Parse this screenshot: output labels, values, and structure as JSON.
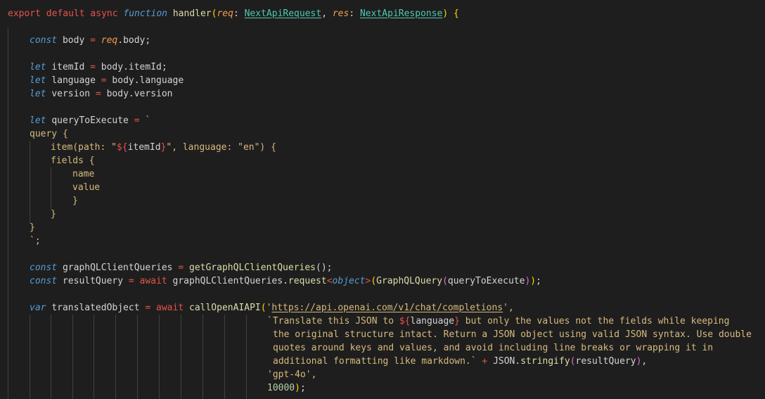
{
  "code": {
    "l1": {
      "export": "export",
      "default": "default",
      "async": "async",
      "function": "function",
      "name": "handler",
      "req": "req",
      "req_type": "NextApiRequest",
      "res": "res",
      "res_type": "NextApiResponse"
    },
    "l3": {
      "kw": "const",
      "var": "body",
      "rhs_param": "req",
      "rhs_prop": ".body;"
    },
    "l5": {
      "kw": "let",
      "text": "itemId",
      "rhs": "body.itemId;"
    },
    "l6": {
      "kw": "let",
      "text": "language",
      "rhs": "body.language"
    },
    "l7": {
      "kw": "let",
      "text": "version",
      "rhs": "body.version"
    },
    "l9": {
      "kw": "let",
      "text": "queryToExecute",
      "tick": "`"
    },
    "l10": {
      "text": "query {"
    },
    "l11": {
      "pre": "item(path: \"",
      "interp_open": "${",
      "var": "itemId",
      "interp_close": "}",
      "post": "\", language: \"en\") {"
    },
    "l12": {
      "text": "fields {"
    },
    "l13": {
      "text": "name"
    },
    "l14": {
      "text": "value"
    },
    "l15": {
      "text": "}"
    },
    "l16": {
      "text": "}"
    },
    "l17": {
      "text": "}"
    },
    "l18": {
      "text": "`;"
    },
    "l20": {
      "kw": "const",
      "var": "graphQLClientQueries",
      "fn": "getGraphQLClientQueries",
      "end": "();"
    },
    "l21": {
      "kw": "const",
      "var": "resultQuery",
      "await": "await",
      "obj": "graphQLClientQueries",
      "method": "request",
      "generic_open": "<",
      "generic_kw": "object",
      "generic_close": ">",
      "inner_fn": "GraphQLQuery",
      "arg": "queryToExecute",
      "end": "));"
    },
    "l23": {
      "kw": "var",
      "var": "translatedObject",
      "await": "await",
      "fn": "callOpenAIAPI",
      "url_quote_open": "'",
      "url": "https://api.openai.com/v1/chat/completions",
      "url_quote_close": "',"
    },
    "l24": {
      "tick": "`",
      "pre": "Translate this JSON to ",
      "interp_open": "${",
      "var": "language",
      "interp_close": "}",
      "post": " but only the values not the fields while keeping"
    },
    "l25": {
      "text": "the original structure intact. Return a JSON object using valid JSON syntax. Use double"
    },
    "l26": {
      "text": "quotes around keys and values, and avoid including line breaks or wrapping it in"
    },
    "l27": {
      "text": "additional formatting like markdown.`",
      "plus": "+",
      "obj": "JSON",
      "method": ".stringify",
      "arg": "resultQuery",
      "end": "),"
    },
    "l28": {
      "text": "'gpt-4o',"
    },
    "l29": {
      "num": "10000",
      "end": ");"
    }
  }
}
